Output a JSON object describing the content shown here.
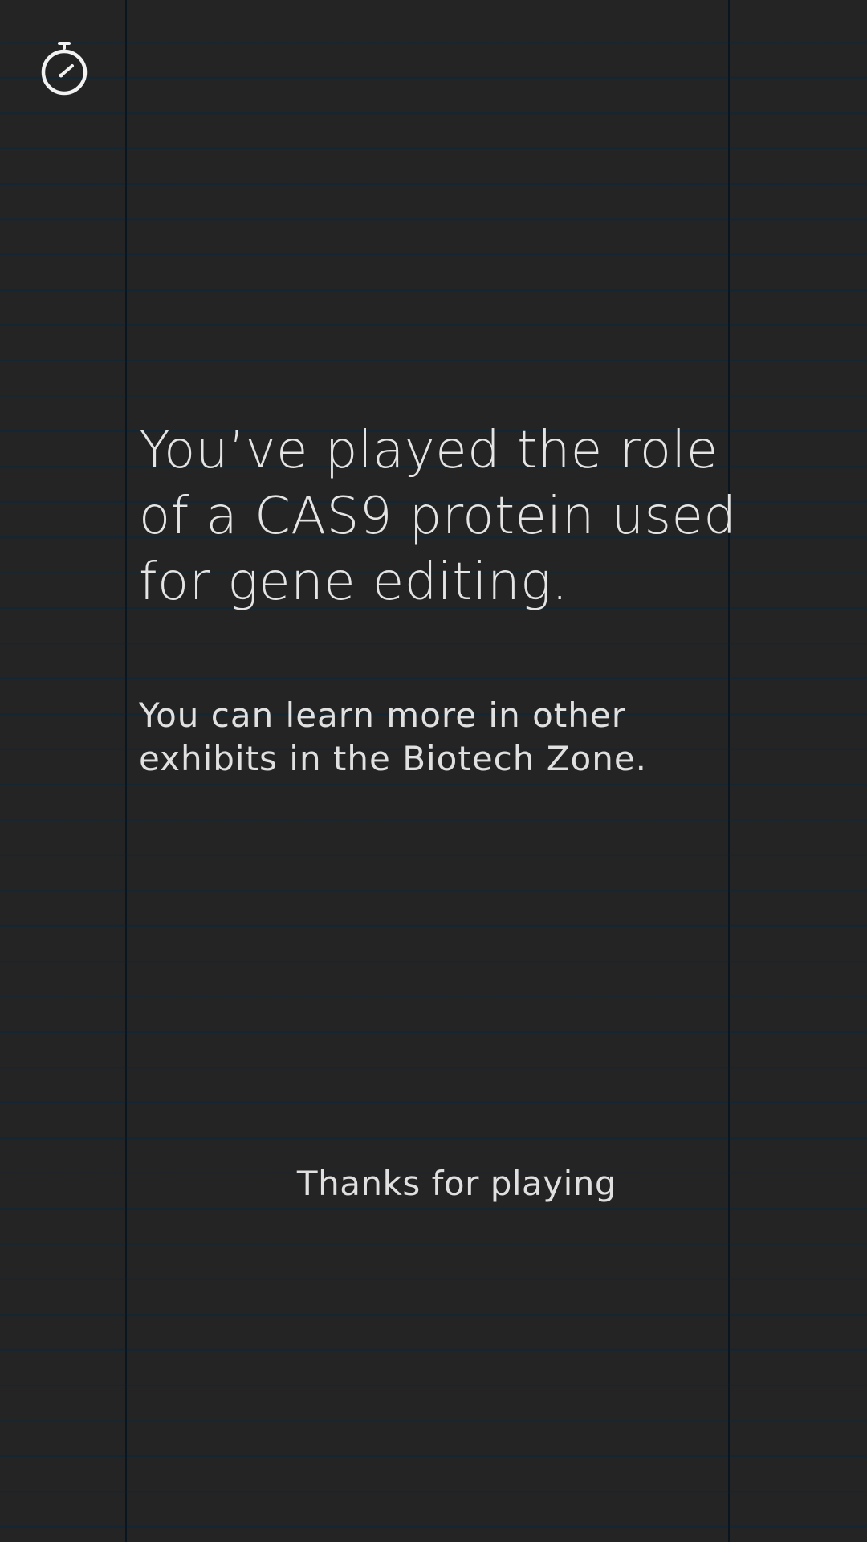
{
  "screen": {
    "background_color": "#242424",
    "ruled_line_color": "#122634",
    "text_color": "#e4e4e4"
  },
  "top_bar": {
    "timer_icon": "stopwatch-icon"
  },
  "content": {
    "headline": "You’ve played the role of a CAS9 protein used for gene editing.",
    "subtext": "You can learn more in other exhibits in the Biotech Zone.",
    "closing": "Thanks for playing"
  }
}
